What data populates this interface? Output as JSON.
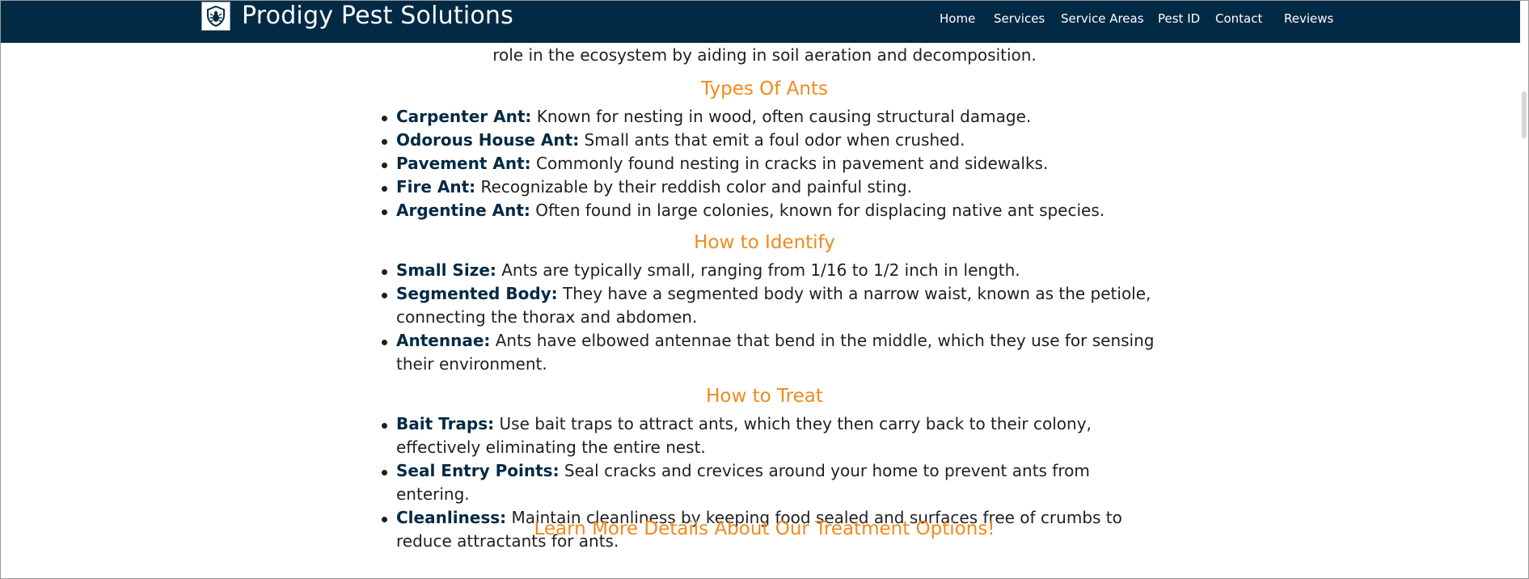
{
  "header": {
    "brand": "Prodigy Pest Solutions",
    "logo_icon": "bug-shield-icon",
    "nav": [
      "Home",
      "Services",
      "Service Areas",
      "Pest ID",
      "Contact",
      "Reviews"
    ]
  },
  "colors": {
    "navbar": "#032a45",
    "accent": "#f08a1c",
    "term": "#032a45"
  },
  "intro_tail": "role in the ecosystem by aiding in soil aeration and decomposition.",
  "sections": {
    "types": {
      "heading": "Types Of Ants",
      "items": [
        {
          "term": "Carpenter Ant:",
          "text": " Known for nesting in wood, often causing structural damage."
        },
        {
          "term": "Odorous House Ant:",
          "text": " Small ants that emit a foul odor when crushed."
        },
        {
          "term": "Pavement Ant:",
          "text": " Commonly found nesting in cracks in pavement and sidewalks."
        },
        {
          "term": "Fire Ant:",
          "text": " Recognizable by their reddish color and painful sting."
        },
        {
          "term": "Argentine Ant:",
          "text": " Often found in large colonies, known for displacing native ant species."
        }
      ]
    },
    "identify": {
      "heading": "How to Identify",
      "items": [
        {
          "term": "Small Size:",
          "text": " Ants are typically small, ranging from 1/16 to 1/2 inch in length."
        },
        {
          "term": "Segmented Body:",
          "text": " They have a segmented body with a narrow waist, known as the petiole, connecting the thorax and abdomen."
        },
        {
          "term": "Antennae:",
          "text": " Ants have elbowed antennae that bend in the middle, which they use for sensing their environment."
        }
      ]
    },
    "treat": {
      "heading": "How to Treat",
      "items": [
        {
          "term": "Bait Traps:",
          "text": " Use bait traps to attract ants, which they then carry back to their colony, effectively eliminating the entire nest."
        },
        {
          "term": "Seal Entry Points:",
          "text": " Seal cracks and crevices around your home to prevent ants from entering."
        },
        {
          "term": "Cleanliness:",
          "text": " Maintain cleanliness by keeping food sealed and surfaces free of crumbs to reduce attractants for ants."
        }
      ]
    }
  },
  "cta_link": "Learn More Details About Our Treatment Options!"
}
